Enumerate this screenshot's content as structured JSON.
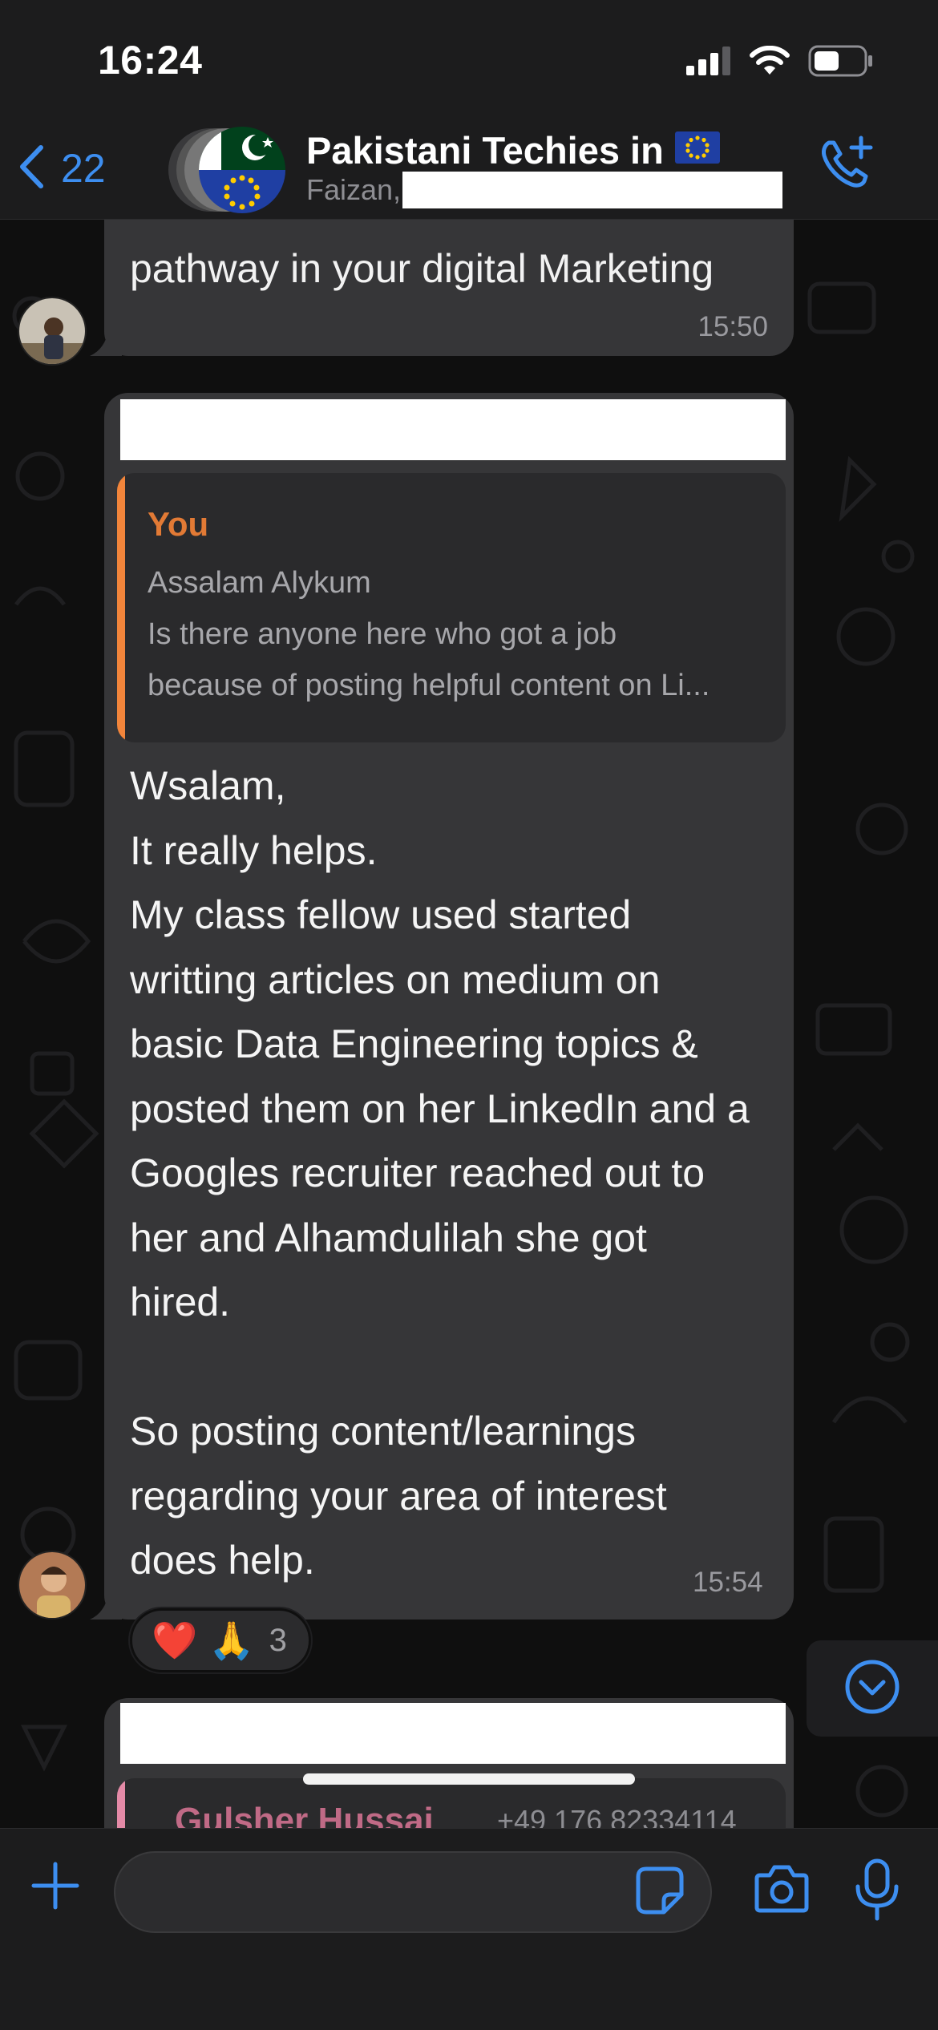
{
  "status_bar": {
    "time": "16:24"
  },
  "header": {
    "back_count": "22",
    "group_name": "Pakistani Techies in",
    "subtitle_visible": "Faizan,"
  },
  "messages": [
    {
      "id": "prev",
      "text": "pathway in your digital Marketing",
      "time": "15:50"
    },
    {
      "id": "reply",
      "quote": {
        "author": "You",
        "lines": [
          "Assalam Alykum",
          "Is there anyone here who got a job",
          "because of posting helpful content on Li..."
        ]
      },
      "body_lines": [
        "Wsalam,",
        "It really helps.",
        "My class fellow used started",
        "writting articles on medium on",
        "basic Data Engineering topics &",
        "posted them on her LinkedIn and a",
        "Googles recruiter reached out to",
        "her and Alhamdulilah she got",
        "hired.",
        "",
        "So posting content/learnings",
        "regarding your area of interest",
        "does help."
      ],
      "time": "15:54",
      "reactions": {
        "emojis": [
          "❤️",
          "🙏"
        ],
        "count": "3"
      }
    },
    {
      "id": "next",
      "quote_author": "Gulsher Hussai",
      "quote_phone": "+49 176 82334114"
    }
  ],
  "composer": {
    "input_value": "",
    "input_placeholder": ""
  },
  "colors": {
    "accent": "#3d8ef0",
    "bubble": "#363638",
    "quote_bar_you": "#f2853b",
    "quote_author_you": "#e27a35",
    "quote_bar_next": "#e48aa7",
    "background": "#0f0f0f",
    "bar": "#1c1c1d"
  },
  "icons": [
    "signal-icon",
    "wifi-icon",
    "battery-icon",
    "back-chevron-icon",
    "eu-flag-icon",
    "add-call-icon",
    "chevron-down-circle-icon",
    "plus-icon",
    "sticker-icon",
    "camera-icon",
    "microphone-icon"
  ]
}
